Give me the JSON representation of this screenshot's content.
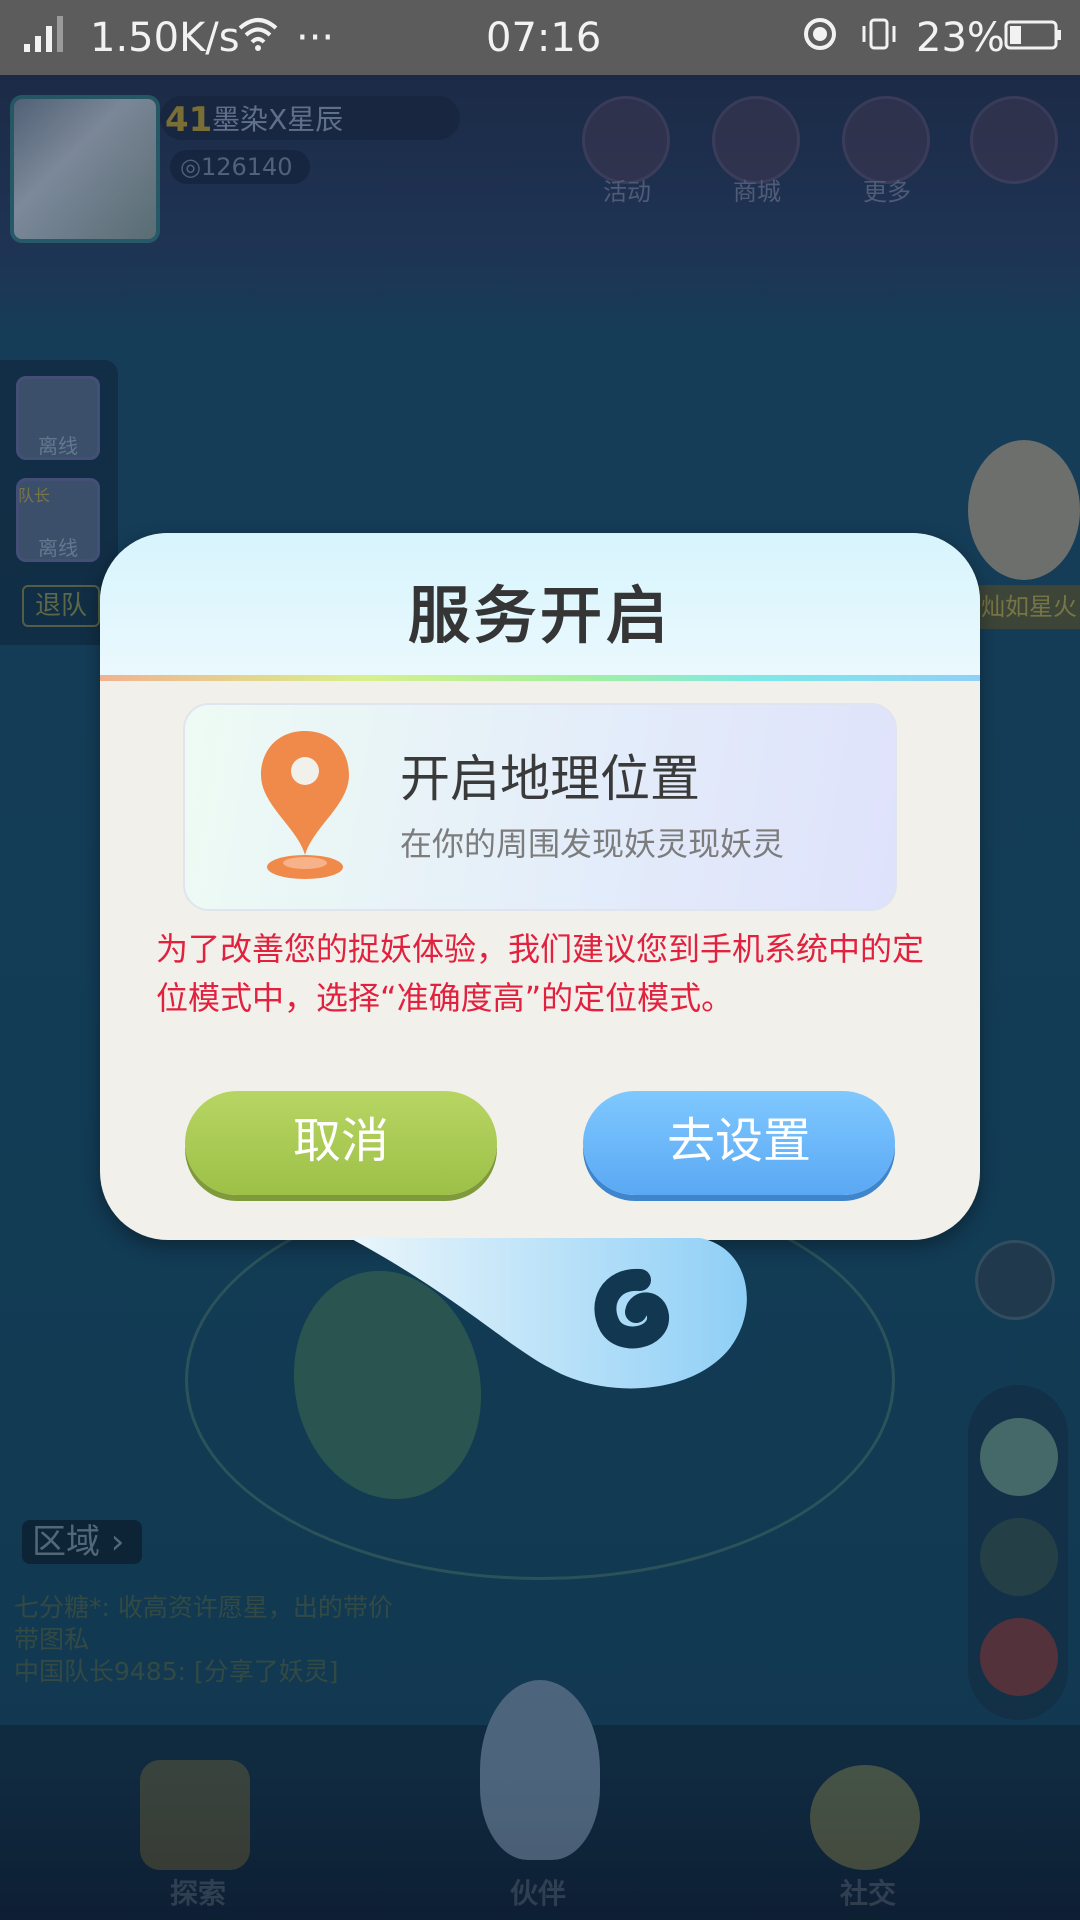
{
  "status_bar": {
    "net_speed": "1.50K/s",
    "dots": "···",
    "time": "07:16",
    "battery": "23%"
  },
  "game": {
    "player": {
      "level": "41",
      "name": "墨染X星辰",
      "coins": "126140"
    },
    "top_buttons": [
      {
        "label": "活动",
        "icon": "gift-icon"
      },
      {
        "label": "商城",
        "icon": "shop-icon"
      },
      {
        "label": "更多",
        "icon": "grid-icon"
      }
    ],
    "team": {
      "leader_badge": "队长",
      "member_status": "离线",
      "leader_status": "离线",
      "quit_label": "退队"
    },
    "npc_label": "灿如星火",
    "region_label": "区域",
    "chat": [
      "七分糖*: 收高资许愿星，出的带价",
      "带图私",
      "中国队长9485: [分享了妖灵]"
    ],
    "bottom_nav": [
      {
        "label": "探索"
      },
      {
        "label": "伙伴"
      },
      {
        "label": "社交"
      }
    ]
  },
  "dialog": {
    "title": "服务开启",
    "card_title": "开启地理位置",
    "card_subtitle": "在你的周围发现妖灵现妖灵",
    "notice": "为了改善您的捉妖体验，我们建议您到手机系统中的定位模式中，选择“准确度高”的定位模式。",
    "cancel_label": "取消",
    "settings_label": "去设置"
  },
  "colors": {
    "notice_text": "#e2213e",
    "cancel_btn": "#a9c852",
    "settings_btn": "#66b3f8",
    "pin": "#f08a4b"
  }
}
